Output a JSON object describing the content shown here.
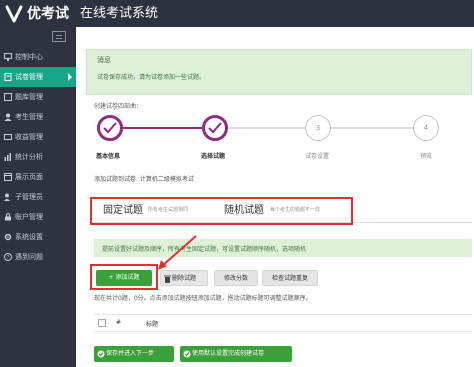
{
  "header": {
    "logo_text": "优考试",
    "system_title": "在线考试系统"
  },
  "sidebar": {
    "items": [
      {
        "label": "控制中心",
        "icon": "monitor-icon"
      },
      {
        "label": "试卷管理",
        "icon": "paper-icon",
        "active": true
      },
      {
        "label": "题库管理",
        "icon": "bank-icon"
      },
      {
        "label": "考生管理",
        "icon": "user-icon"
      },
      {
        "label": "收益管理",
        "icon": "money-icon"
      },
      {
        "label": "统计分析",
        "icon": "chart-icon"
      },
      {
        "label": "展示页面",
        "icon": "page-icon"
      },
      {
        "label": "子管理员",
        "icon": "admin-icon"
      },
      {
        "label": "账户管理",
        "icon": "account-icon"
      },
      {
        "label": "系统设置",
        "icon": "gear-icon"
      },
      {
        "label": "遇到问题",
        "icon": "help-icon"
      }
    ]
  },
  "message": {
    "title": "消息",
    "text": "试卷保存成功，请为试卷添加一些试题。"
  },
  "wizard": {
    "label": "创建试卷四部曲：",
    "steps": [
      {
        "caption": "基本信息",
        "state": "done",
        "number": ""
      },
      {
        "caption": "选择试题",
        "state": "done",
        "number": ""
      },
      {
        "caption": "试卷设置",
        "state": "todo",
        "number": "3"
      },
      {
        "caption": "预览",
        "state": "todo",
        "number": "4"
      }
    ],
    "accent_color": "#8e2d7d"
  },
  "add_to": "添加试题到试卷: 计算机二级模拟考试",
  "tabs": [
    {
      "label": "固定试题",
      "hint": "所有考生试题相同"
    },
    {
      "label": "随机试题",
      "hint": "每个考生的题都不一样"
    }
  ],
  "info_bar": "提前设置好试题及顺序，所有考生固定试题，可设置试题顺序随机，选项随机",
  "toolbar": {
    "add": "+ 添加试题",
    "delete": "删除试题",
    "edit_score": "修改分数",
    "check_dup": "检查试题重复"
  },
  "summary": "现在共计0题，0分。点击添加试题按钮添加试题，拖动试题标题可调整试题顺序。",
  "table": {
    "columns": [
      "#",
      "标题"
    ]
  },
  "footer_buttons": {
    "save_next": "保存并进入下一步",
    "use_default": "使用默认设置完成创建试卷"
  },
  "colors": {
    "brand_green": "#18a689",
    "button_green": "#3aa13a",
    "highlight_red": "#e03030"
  }
}
